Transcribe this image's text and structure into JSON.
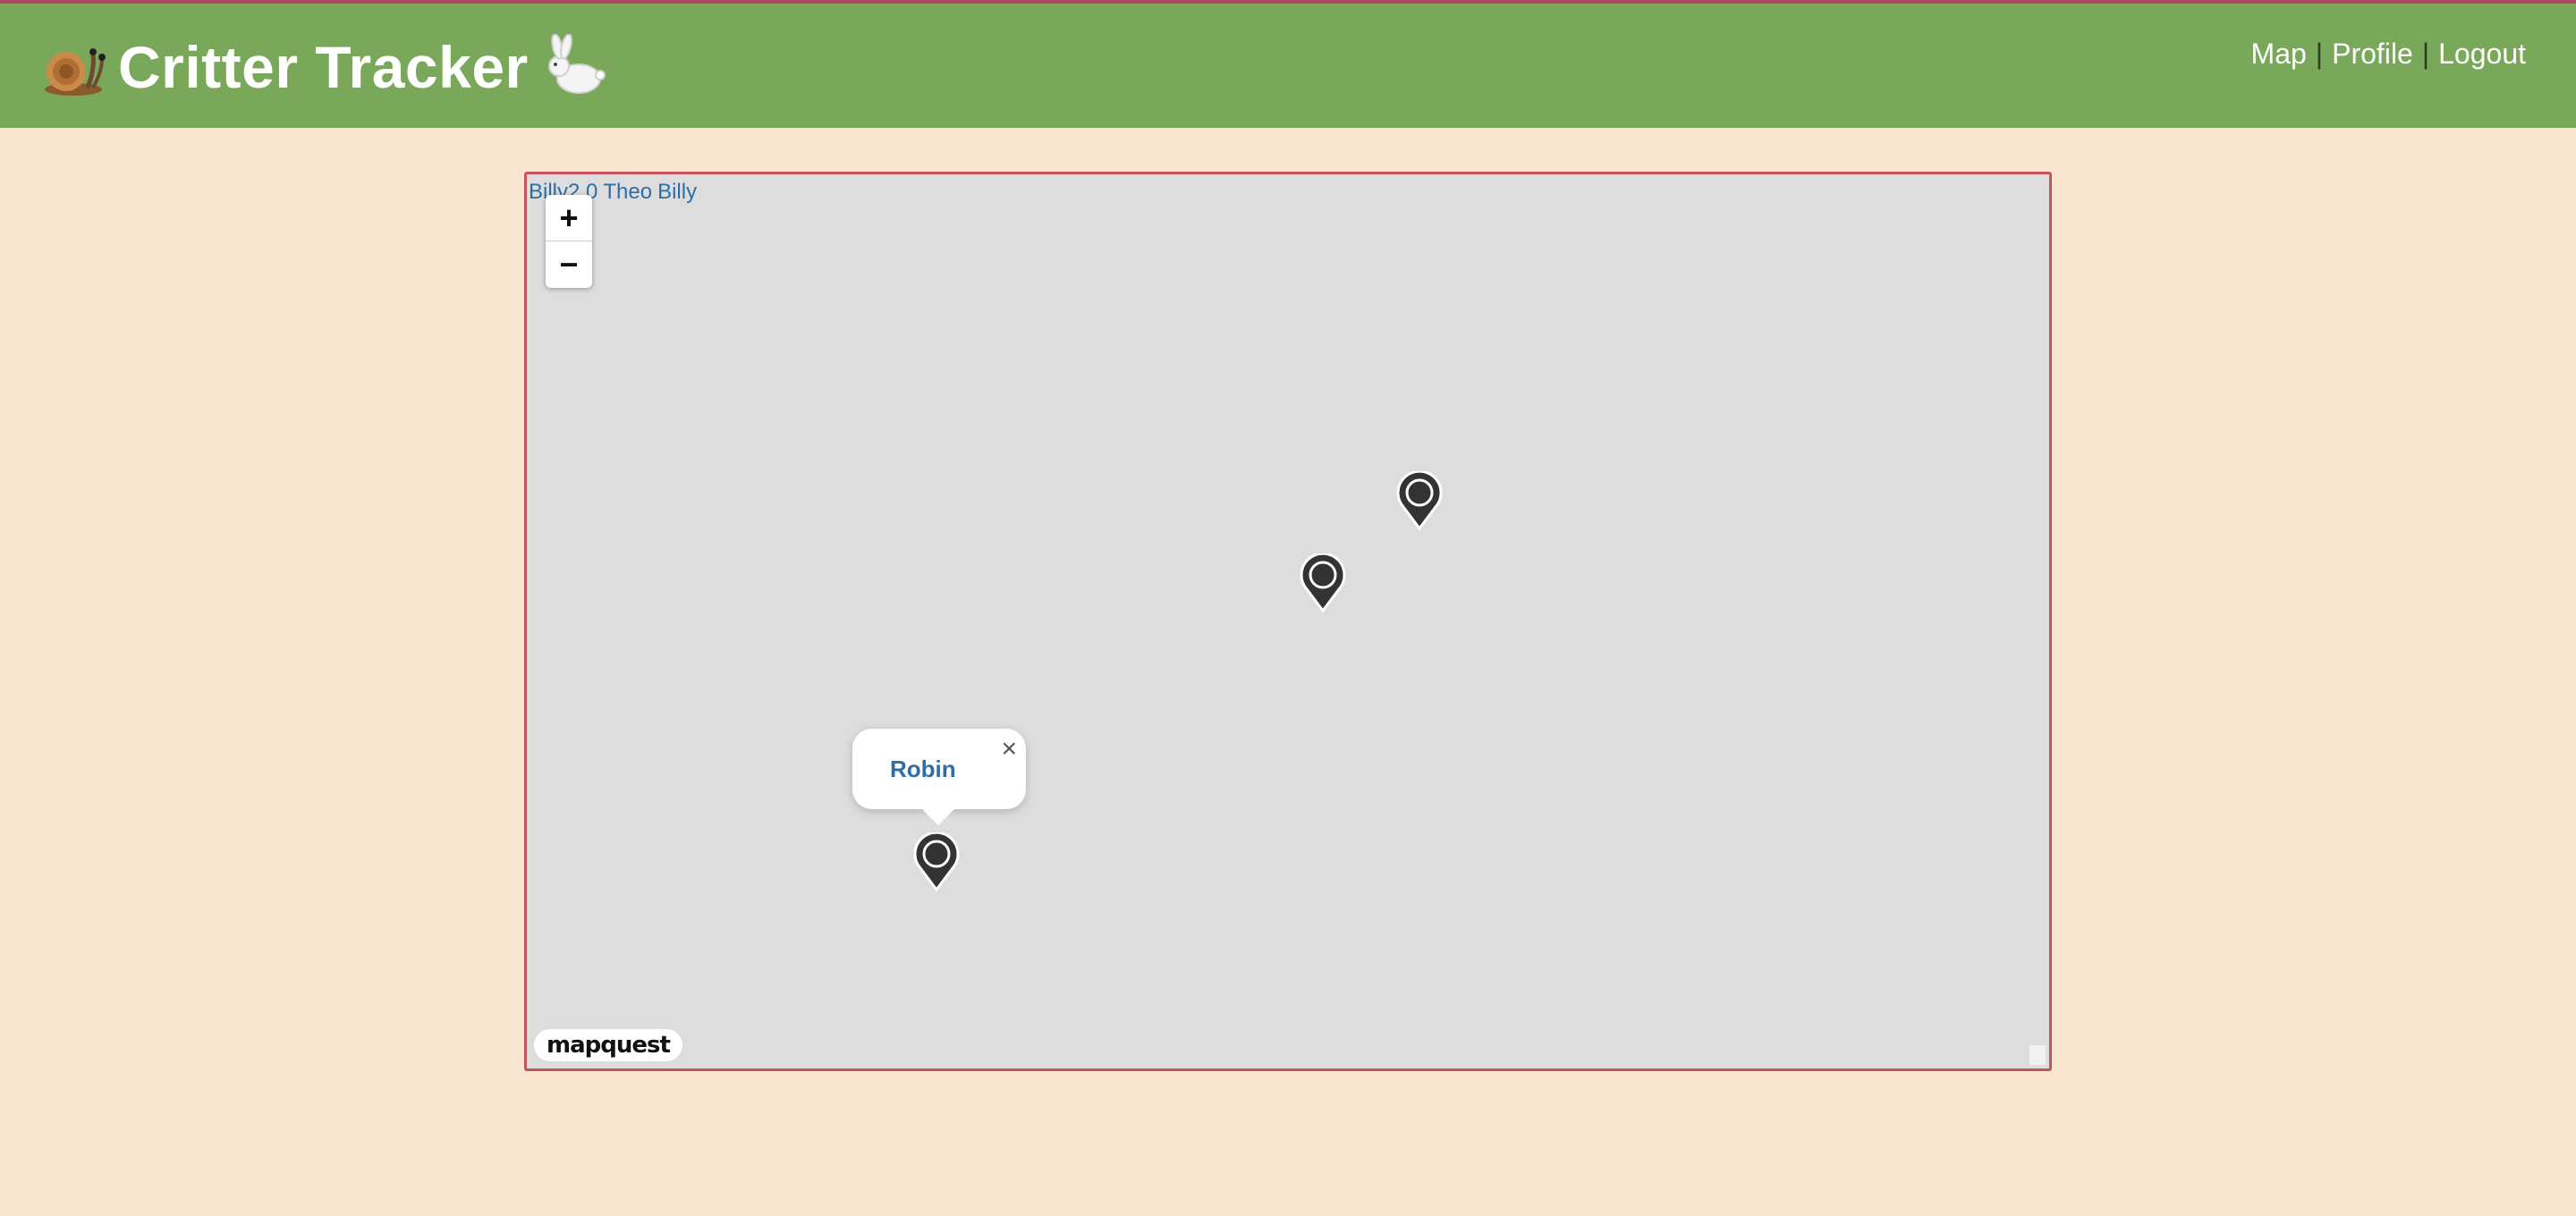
{
  "app": {
    "title": "Critter Tracker",
    "brand_color": "#7aa85a",
    "accent_border": "#b0485f",
    "background": "#f8e6d1",
    "leading_icon": "snail-icon",
    "trailing_icon": "rabbit-icon"
  },
  "nav": {
    "items": [
      {
        "label": "Map"
      },
      {
        "label": "Profile"
      },
      {
        "label": "Logout"
      }
    ],
    "separator": "|"
  },
  "map": {
    "animal_links": [
      "Billy2.0",
      "Theo",
      "Billy"
    ],
    "zoom_in_label": "+",
    "zoom_out_label": "−",
    "popup": {
      "name": "Robin",
      "close_label": "×"
    },
    "attribution": "mapquest",
    "marker_icon": "map-pin-icon",
    "marker_count": 3
  }
}
